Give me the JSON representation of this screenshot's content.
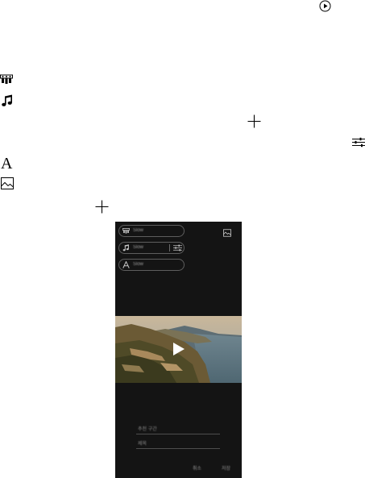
{
  "icons": {
    "play": "play-circle-icon",
    "effects": "effects-icon",
    "music": "music-note-icon",
    "add": "plus-icon",
    "adjust": "adjustment-icon",
    "font": "font-icon",
    "image": "image-icon"
  },
  "font_glyph": "A",
  "phone": {
    "chips": [
      {
        "label": "Slow",
        "icon": "effects-icon"
      },
      {
        "label": "Slow",
        "icon": "music-note-icon"
      },
      {
        "label": "Slow",
        "icon": "font-icon"
      }
    ],
    "fields": [
      {
        "label": "추천 구간"
      },
      {
        "label": "제목"
      }
    ],
    "buttons": {
      "cancel": "취소",
      "save": "저장"
    }
  },
  "colors": {
    "phone_bg": "#141414",
    "chip_border": "#5e5e5e",
    "icon": "#000000"
  }
}
